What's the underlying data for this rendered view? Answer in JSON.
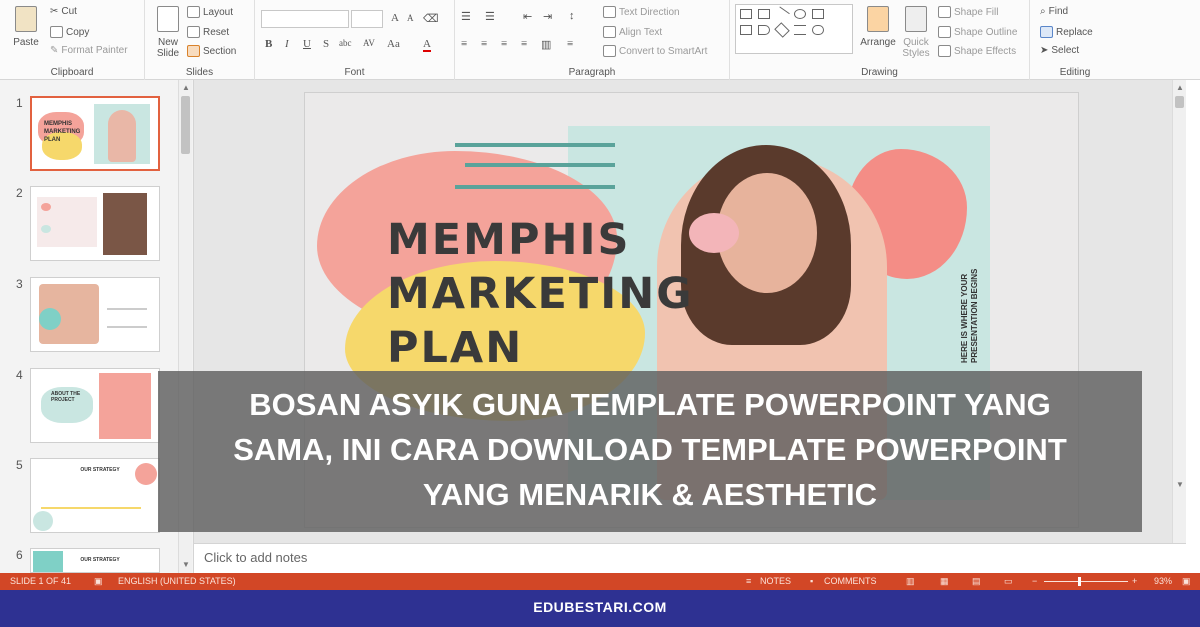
{
  "ribbon": {
    "clipboard": {
      "paste": "Paste",
      "cut": "Cut",
      "copy": "Copy",
      "format_painter": "Format Painter",
      "group": "Clipboard"
    },
    "slides": {
      "new_slide": "New Slide",
      "layout": "Layout",
      "reset": "Reset",
      "section": "Section",
      "group": "Slides"
    },
    "font": {
      "group": "Font",
      "bold": "B",
      "italic": "I",
      "underline": "U",
      "shadow": "S",
      "strike": "abc",
      "spacing": "AV",
      "case": "Aa",
      "color": "A",
      "grow": "A",
      "shrink": "A"
    },
    "paragraph": {
      "text_direction": "Text Direction",
      "align_text": "Align Text",
      "smartart": "Convert to SmartArt",
      "group": "Paragraph"
    },
    "drawing": {
      "arrange": "Arrange",
      "quick_styles": "Quick Styles",
      "shape_fill": "Shape Fill",
      "shape_outline": "Shape Outline",
      "shape_effects": "Shape Effects",
      "group": "Drawing"
    },
    "editing": {
      "find": "Find",
      "replace": "Replace",
      "select": "Select",
      "group": "Editing"
    }
  },
  "thumbnails": [
    {
      "num": "1",
      "title": "MEMPHIS MARKETING PLAN"
    },
    {
      "num": "2",
      "title": ""
    },
    {
      "num": "3",
      "title": ""
    },
    {
      "num": "4",
      "title": "ABOUT THE PROJECT"
    },
    {
      "num": "5",
      "title": "OUR STRATEGY"
    },
    {
      "num": "6",
      "title": "OUR STRATEGY"
    }
  ],
  "slide": {
    "title_line1": "MEMPHIS",
    "title_line2": "MARKETING",
    "title_line3": "PLAN",
    "vertical_text_1": "HERE IS WHERE YOUR",
    "vertical_text_2": "PRESENTATION BEGINS"
  },
  "notes_placeholder": "Click to add notes",
  "status": {
    "slide_info": "SLIDE 1 OF 41",
    "language": "ENGLISH (UNITED STATES)",
    "notes": "NOTES",
    "comments": "COMMENTS",
    "zoom": "93%"
  },
  "banner": {
    "line1": "BOSAN ASYIK GUNA TEMPLATE POWERPOINT YANG",
    "line2": "SAMA, INI CARA DOWNLOAD TEMPLATE POWERPOINT",
    "line3": "YANG MENARIK & AESTHETIC"
  },
  "footer": {
    "site": "EDUBESTARI.COM"
  },
  "colors": {
    "accent": "#d24726",
    "footer": "#2e3192",
    "coral": "#f4a39a",
    "mint": "#c9e6e1",
    "yellow": "#f6d86b"
  }
}
